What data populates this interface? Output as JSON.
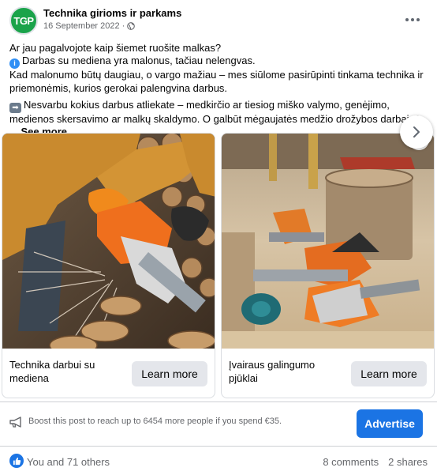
{
  "post": {
    "page_name": "Technika girioms ir parkams",
    "avatar_text": "TGP",
    "date": "16 September 2022 ·",
    "text": {
      "line1": "Ar jau pagalvojote kaip šiemet ruošite malkas?",
      "line2": "Darbas su mediena yra malonus, tačiau nelengvas.",
      "line3": "Kad malonumo būtų daugiau, o vargo mažiau – mes siūlome pasirūpinti tinkama technika ir priemonėmis, kurios gerokai palengvina darbus.",
      "line4": "Nesvarbu kokius darbus atliekate – medkirčio ar tiesiog miško valymo, genėjimo, medienos skersavimo ar malkų skaldymo. O galbūt mėgaujatės medžio drožybos darbais? ...",
      "see_more": "See more"
    }
  },
  "carousel": {
    "cards": [
      {
        "title": "Technika darbui su mediena",
        "button": "Learn more"
      },
      {
        "title": "Įvairaus galingumo pjūklai",
        "button": "Learn more"
      }
    ],
    "info_badge": "i"
  },
  "boost": {
    "text": "Boost this post to reach up to 6454 more people if you spend €35.",
    "button": "Advertise"
  },
  "footer": {
    "reactions": "You and 71 others",
    "comments": "8 comments",
    "shares": "2 shares"
  },
  "colors": {
    "brand_green": "#1aa34a",
    "accent_blue": "#1b74e4",
    "button_grey": "#e4e6eb",
    "secondary_text": "#65676b"
  },
  "icons": [
    "globe-icon",
    "more-options-icon",
    "info-icon",
    "arrow-right-icon",
    "chevron-right-icon",
    "megaphone-icon",
    "like-icon"
  ]
}
